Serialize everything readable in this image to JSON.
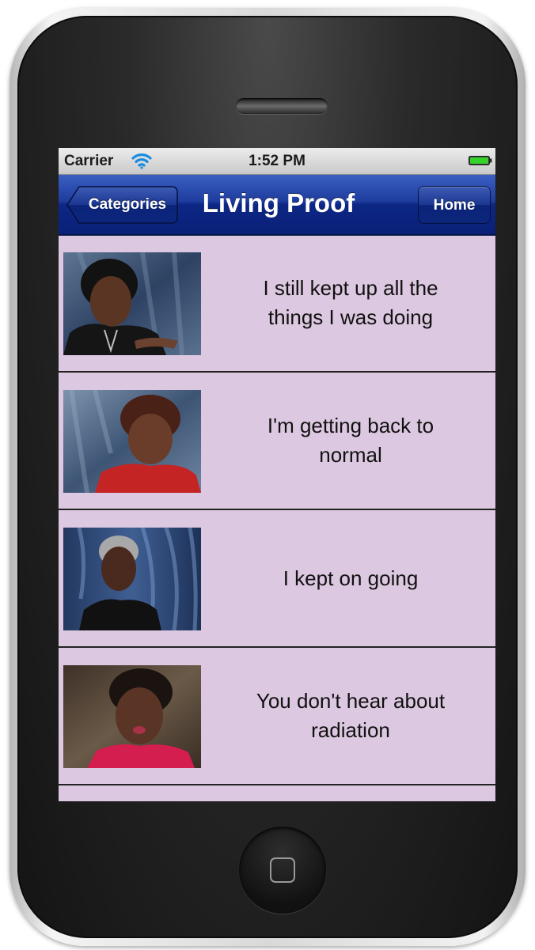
{
  "statusbar": {
    "carrier": "Carrier",
    "time": "1:52 PM",
    "wifi_icon": "wifi-icon",
    "battery_icon": "battery-icon"
  },
  "navbar": {
    "back_label": "Categories",
    "title": "Living Proof",
    "home_label": "Home"
  },
  "colors": {
    "list_background": "#dcc8e0",
    "navbar_blue": "#0d2785"
  },
  "items": [
    {
      "text": "I still kept up all the things I was doing",
      "thumbnail": "portrait-woman-1"
    },
    {
      "text": "I'm getting back to normal",
      "thumbnail": "portrait-woman-2"
    },
    {
      "text": "I kept on going",
      "thumbnail": "portrait-woman-3"
    },
    {
      "text": "You don't hear about radiation",
      "thumbnail": "portrait-woman-4"
    }
  ]
}
